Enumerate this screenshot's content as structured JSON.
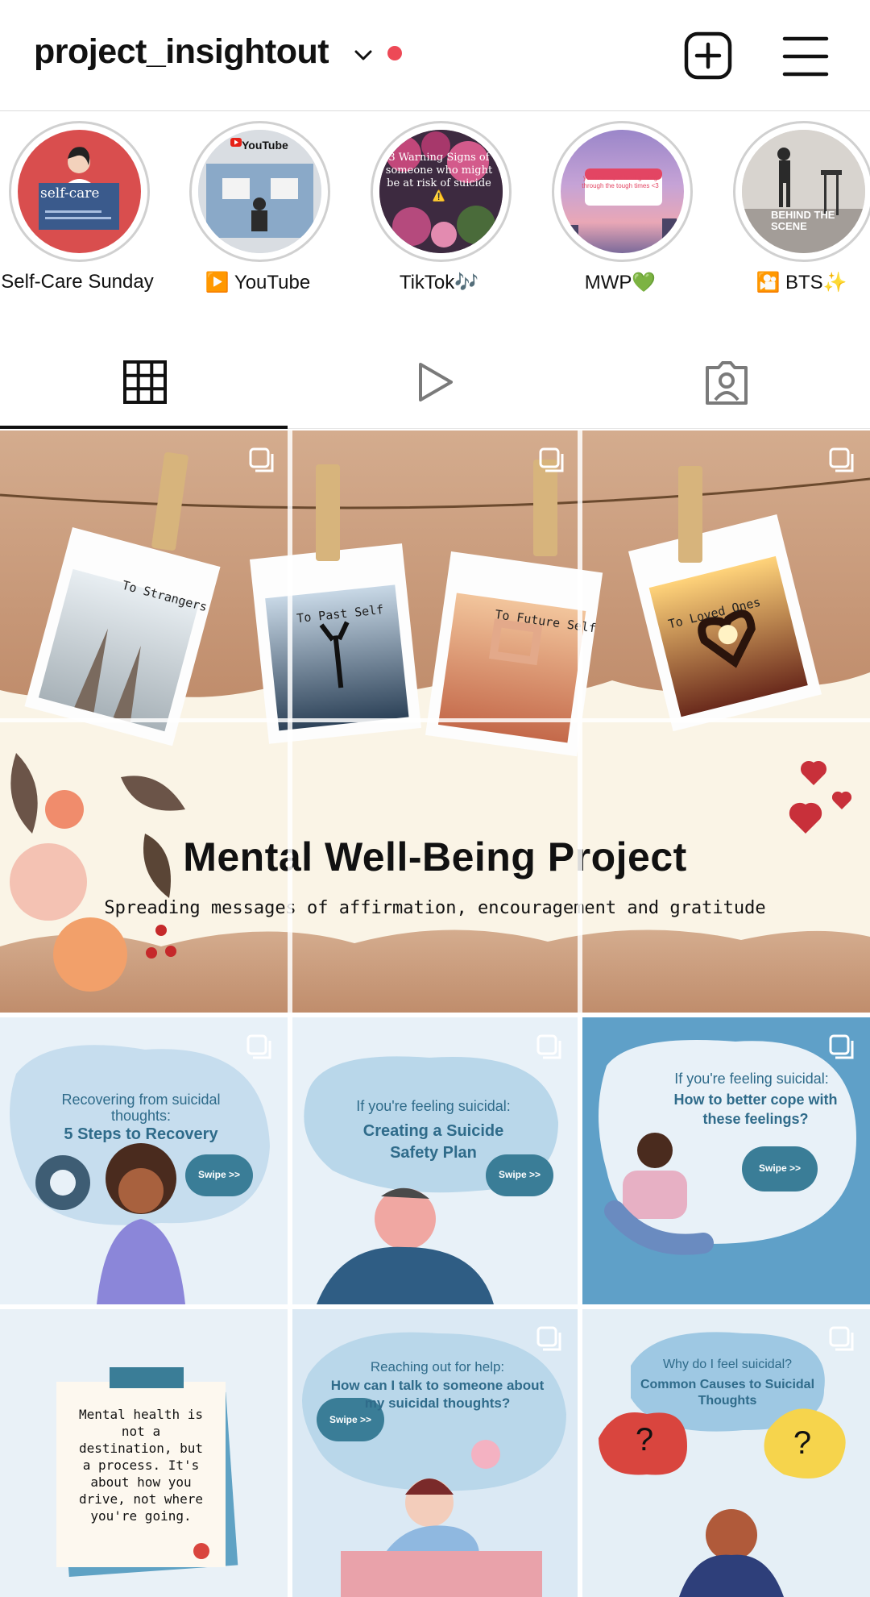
{
  "header": {
    "username": "project_insightout",
    "new_post_icon": "plus-square-icon",
    "menu_icon": "hamburger-menu-icon"
  },
  "highlights": [
    {
      "label": "Self-Care Sunday",
      "cover_title": "self-care"
    },
    {
      "label": "▶️ YouTube",
      "cover_title": "YouTube"
    },
    {
      "label": "TikTok🎶",
      "cover_title": "3 Warning Signs of someone who might be at risk of suicide ⚠️"
    },
    {
      "label": "MWP💚",
      "cover_title": "you are capable of getting through the tough times <3"
    },
    {
      "label": "🎦 BTS✨",
      "cover_title": "BEHIND THE SCENE"
    }
  ],
  "tabs": [
    {
      "name": "posts",
      "icon": "grid-icon",
      "active": true
    },
    {
      "name": "reels",
      "icon": "play-icon",
      "active": false
    },
    {
      "name": "tagged",
      "icon": "person-tag-icon",
      "active": false
    }
  ],
  "banner": {
    "photo_captions": [
      "To Strangers",
      "To Past Self",
      "To Future Self",
      "To Loved Ones"
    ],
    "title": "Mental Well-Being Project",
    "subtitle": "Spreading messages of affirmation, encouragement and gratitude"
  },
  "posts": [
    {
      "line1": "Recovering from suicidal thoughts:",
      "line2": "5 Steps to Recovery",
      "swipe": "Swipe >>"
    },
    {
      "line1": "If you're feeling suicidal:",
      "line2": "Creating a Suicide Safety Plan",
      "swipe": "Swipe >>"
    },
    {
      "line1": "If you're feeling suicidal:",
      "line2": "How to better cope with these feelings?",
      "swipe": "Swipe >>"
    },
    {
      "quote": "Mental health is not a destination, but a process. It's about how you drive, not where you're going."
    },
    {
      "line1": "Reaching out for help:",
      "line2": "How can I talk to someone about my suicidal thoughts?",
      "swipe": "Swipe >>"
    },
    {
      "line1": "Why do I feel suicidal?",
      "line2": "Common Causes to Suicidal Thoughts",
      "marks": [
        "?",
        "?"
      ]
    }
  ],
  "colors": {
    "accent_dark": "#2f6b8a",
    "swipe_bubble": "#3a7d97",
    "blob": "#b9d7ea",
    "red_dot": "#ed4956",
    "kraft": "#c99b7c"
  }
}
